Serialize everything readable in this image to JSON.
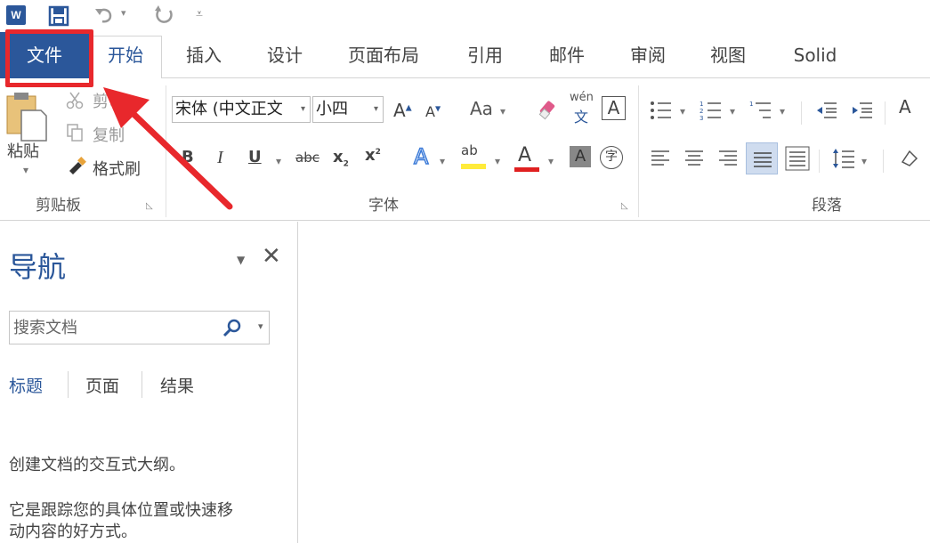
{
  "app": {
    "logo_letter": "W",
    "accent": "#2b579a",
    "highlight_color": "#e8282c"
  },
  "tabs": [
    {
      "label": "文件"
    },
    {
      "label": "开始"
    },
    {
      "label": "插入"
    },
    {
      "label": "设计"
    },
    {
      "label": "页面布局"
    },
    {
      "label": "引用"
    },
    {
      "label": "邮件"
    },
    {
      "label": "审阅"
    },
    {
      "label": "视图"
    },
    {
      "label": "Solid"
    }
  ],
  "clipboard": {
    "paste": "粘贴",
    "cut": "剪切",
    "copy": "复制",
    "format_painter": "格式刷",
    "group": "剪贴板"
  },
  "font": {
    "name": "宋体 (中文正文",
    "size": "小四",
    "case": "Aa",
    "phonetic_top": "wén",
    "phonetic_bottom": "文",
    "border_char": "A",
    "bold": "B",
    "italic": "I",
    "underline": "U",
    "strike": "abc",
    "subscript": "x",
    "superscript": "x",
    "effects": "A",
    "highlight": "ab",
    "color": "A",
    "shading": "A",
    "enclose": "字",
    "group": "字体"
  },
  "paragraph": {
    "group": "段落"
  },
  "nav": {
    "title": "导航",
    "search_placeholder": "搜索文档",
    "tabs": [
      "标题",
      "页面",
      "结果"
    ],
    "line1": "创建文档的交互式大纲。",
    "line2": "它是跟踪您的具体位置或快速移",
    "line3": "动内容的好方式。"
  }
}
